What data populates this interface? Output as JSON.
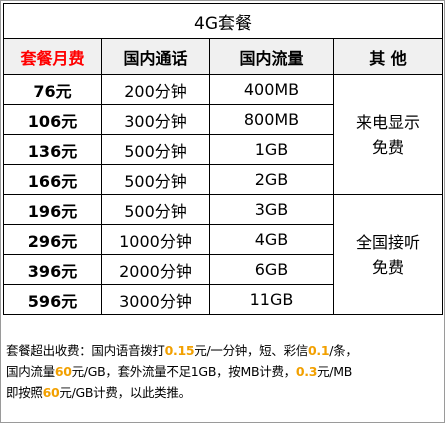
{
  "title": "4G套餐",
  "headers": {
    "monthly_fee": "套餐月费",
    "domestic_calls": "国内通话",
    "domestic_data": "国内流量",
    "other": "其 他"
  },
  "rows": [
    {
      "price": "76元",
      "calls": "200分钟",
      "data": "400MB"
    },
    {
      "price": "106元",
      "calls": "300分钟",
      "data": "800MB"
    },
    {
      "price": "136元",
      "calls": "500分钟",
      "data": "1GB"
    },
    {
      "price": "166元",
      "calls": "500分钟",
      "data": "2GB"
    },
    {
      "price": "196元",
      "calls": "500分钟",
      "data": "3GB"
    },
    {
      "price": "296元",
      "calls": "1000分钟",
      "data": "4GB"
    },
    {
      "price": "396元",
      "calls": "2000分钟",
      "data": "6GB"
    },
    {
      "price": "596元",
      "calls": "3000分钟",
      "data": "11GB"
    }
  ],
  "other": {
    "caller_id_line1": "来电显示",
    "caller_id_line2": "免费",
    "answer_line1": "全国接听",
    "answer_line2": "免费"
  },
  "footer": {
    "l1_a": "套餐超出收费：国内语音拨打",
    "l1_b": "0.15",
    "l1_c": "元/一分钟，短、彩信",
    "l1_d": "0.1",
    "l1_e": "/条，",
    "l2_a": "国内流量",
    "l2_b": "60",
    "l2_c": "元/GB，套外流量不足1GB，按MB计费，",
    "l2_d": "0.3",
    "l2_e": "元/MB",
    "l3_a": "即按照",
    "l3_b": "60",
    "l3_c": "元/GB计费，以此类推。"
  },
  "colors": {
    "header_red": "#ff0000",
    "highlight_orange": "#f2a000",
    "header_bg": "#f0f0f0"
  }
}
